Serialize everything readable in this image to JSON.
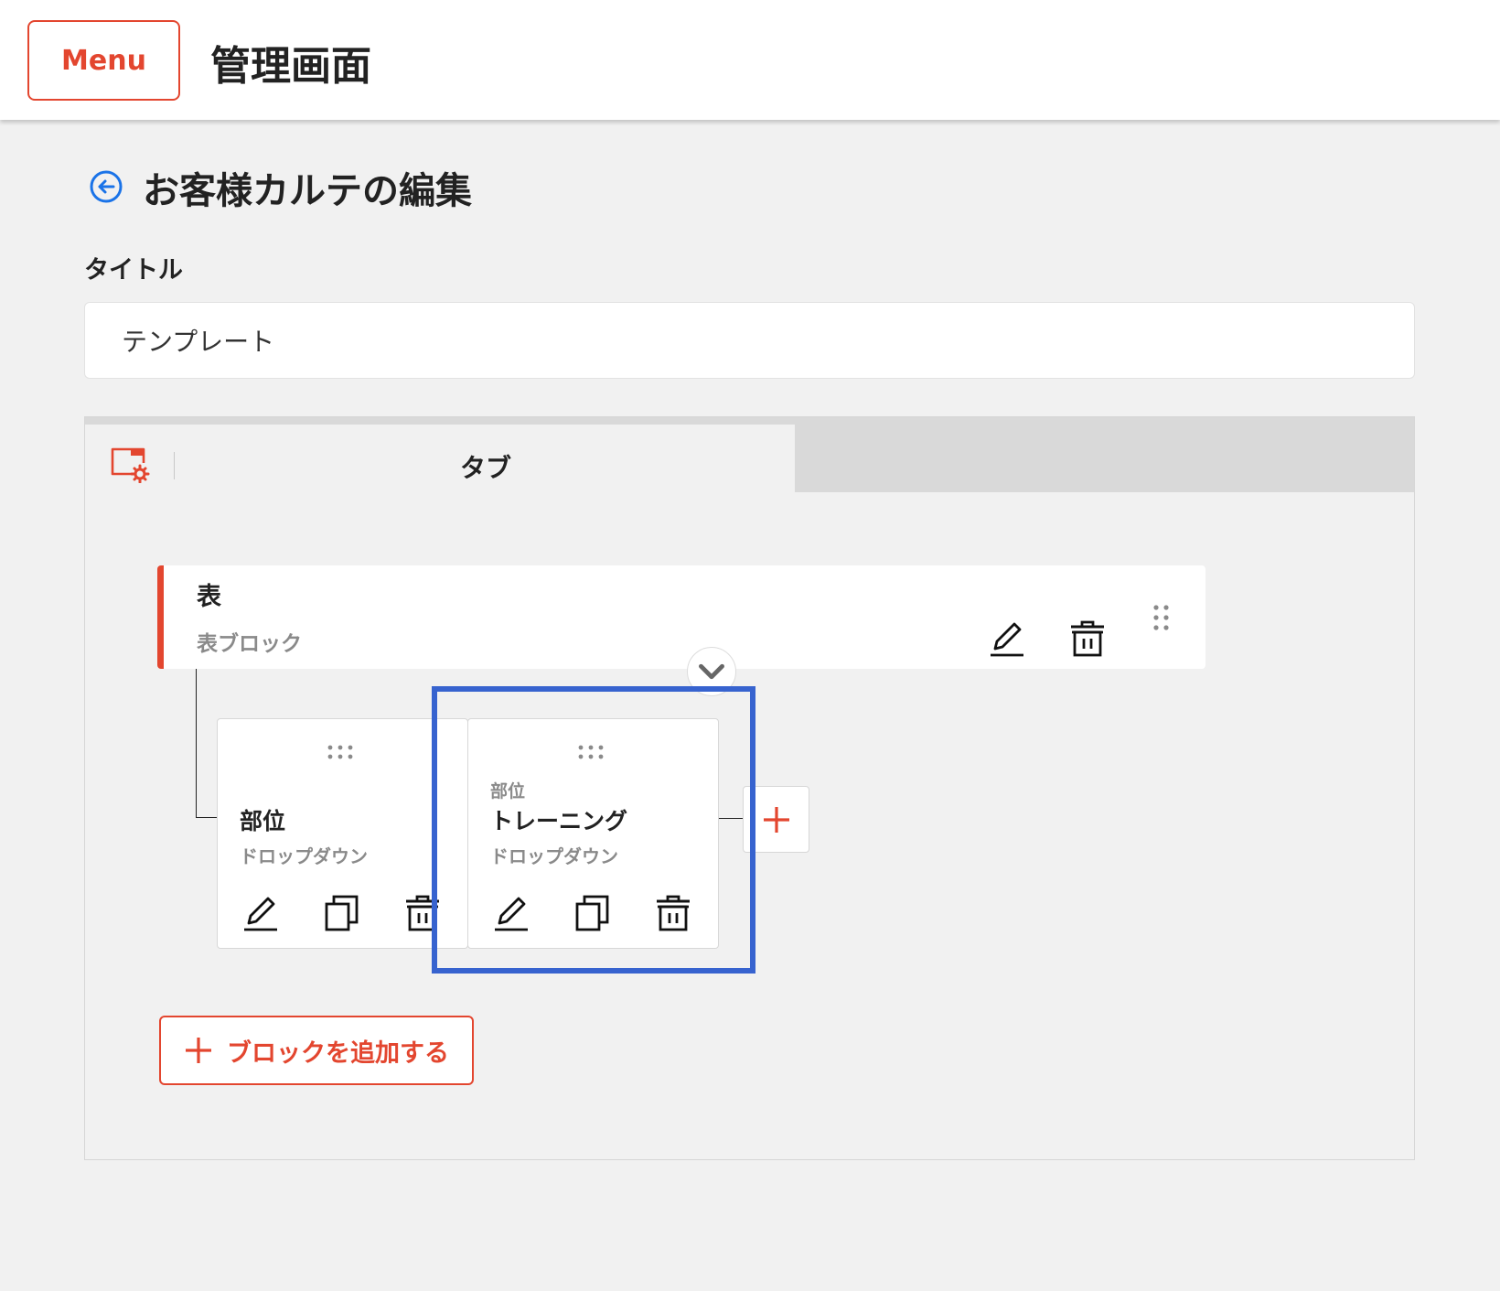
{
  "header": {
    "menu_label": "Menu",
    "app_title": "管理画面"
  },
  "page": {
    "title": "お客様カルテの編集"
  },
  "form": {
    "title_label": "タイトル",
    "title_value": "テンプレート"
  },
  "tabs": [
    {
      "label": "タブ"
    }
  ],
  "block": {
    "title": "表",
    "subtitle": "表ブロック"
  },
  "columns": [
    {
      "prefix": "",
      "title": "部位",
      "type": "ドロップダウン"
    },
    {
      "prefix": "部位",
      "title": "トレーニング",
      "type": "ドロップダウン"
    }
  ],
  "add_block_label": "ブロックを追加する",
  "colors": {
    "accent": "#e3462f",
    "highlight": "#3763cf",
    "link": "#1a73e8"
  }
}
